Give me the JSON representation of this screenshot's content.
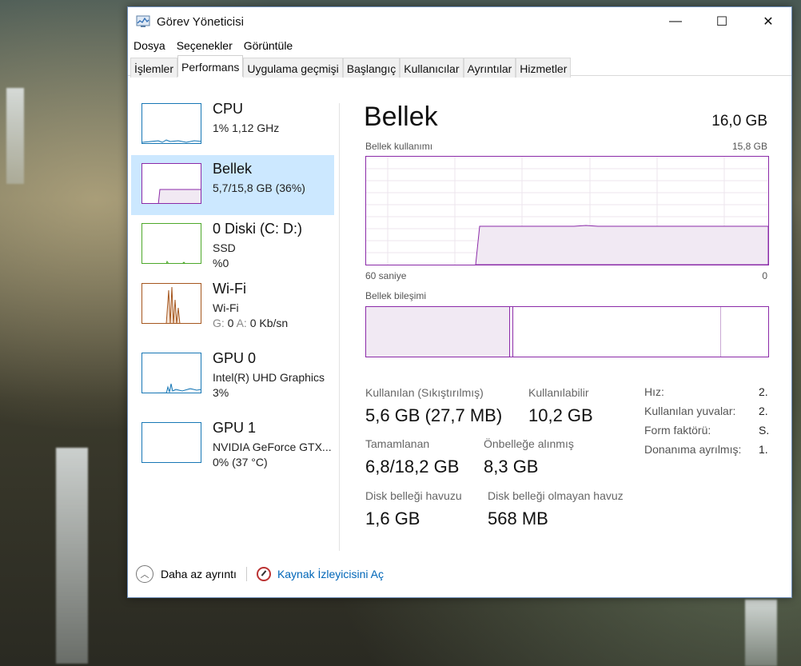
{
  "window": {
    "title": "Görev Yöneticisi",
    "controls": {
      "minimize": "—",
      "maximize": "☐",
      "close": "✕"
    }
  },
  "menu": [
    "Dosya",
    "Seçenekler",
    "Görüntüle"
  ],
  "tabs": [
    {
      "label": "İşlemler",
      "active": false
    },
    {
      "label": "Performans",
      "active": true
    },
    {
      "label": "Uygulama geçmişi",
      "active": false
    },
    {
      "label": "Başlangıç",
      "active": false
    },
    {
      "label": "Kullanıcılar",
      "active": false
    },
    {
      "label": "Ayrıntılar",
      "active": false
    },
    {
      "label": "Hizmetler",
      "active": false
    }
  ],
  "sidebar": [
    {
      "name": "CPU",
      "line1": "1% 1,12 GHz",
      "line2": "",
      "color": "#1777b5",
      "selected": false
    },
    {
      "name": "Bellek",
      "line1": "5,7/15,8 GB (36%)",
      "line2": "",
      "color": "#8b2aa8",
      "selected": true
    },
    {
      "name": "0 Diski (C: D:)",
      "line1": "SSD",
      "line2": "%0",
      "color": "#4da82a",
      "selected": false
    },
    {
      "name": "Wi-Fi",
      "line1": "Wi-Fi",
      "line2_prefix_g": "G:",
      "line2_g": "0",
      "line2_prefix_a": "A:",
      "line2_a": "0 Kb/sn",
      "color": "#a5561e",
      "selected": false
    },
    {
      "name": "GPU 0",
      "line1": "Intel(R) UHD Graphics",
      "line2": "3%",
      "color": "#1777b5",
      "selected": false
    },
    {
      "name": "GPU 1",
      "line1": "NVIDIA GeForce GTX...",
      "line2": "0% (37 °C)",
      "color": "#1777b5",
      "selected": false
    }
  ],
  "main": {
    "title": "Bellek",
    "total": "16,0 GB",
    "usage_label": "Bellek kullanımı",
    "usage_max": "15,8 GB",
    "time_left": "60 saniye",
    "time_right": "0",
    "composition_label": "Bellek bileşimi",
    "stats": {
      "in_use_label": "Kullanılan (Sıkıştırılmış)",
      "in_use_value": "5,6 GB (27,7 MB)",
      "available_label": "Kullanılabilir",
      "available_value": "10,2 GB",
      "committed_label": "Tamamlanan",
      "committed_value": "6,8/18,2 GB",
      "cached_label": "Önbelleğe alınmış",
      "cached_value": "8,3 GB",
      "paged_label": "Disk belleği havuzu",
      "paged_value": "1,6 GB",
      "nonpaged_label": "Disk belleği olmayan havuz",
      "nonpaged_value": "568 MB"
    },
    "side_stats": [
      {
        "label": "Hız:",
        "value": "2."
      },
      {
        "label": "Kullanılan yuvalar:",
        "value": "2."
      },
      {
        "label": "Form faktörü:",
        "value": "S."
      },
      {
        "label": "Donanıma ayrılmış:",
        "value": "1."
      }
    ]
  },
  "footer": {
    "fewer_details": "Daha az ayrıntı",
    "open_resource_monitor": "Kaynak İzleyicisini Aç"
  },
  "colors": {
    "memory": "#8b2aa8",
    "selection": "#cce8ff",
    "link": "#0066b8"
  }
}
